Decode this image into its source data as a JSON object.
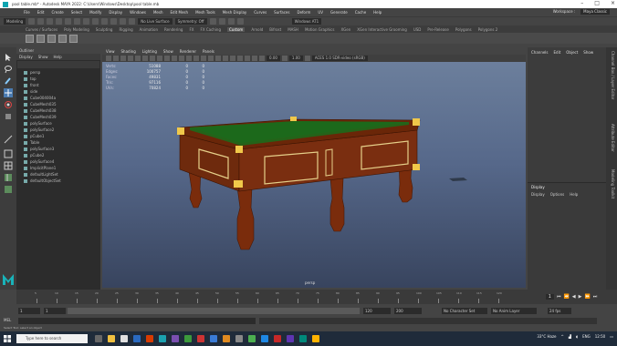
{
  "window": {
    "title": "pool table.mb* - Autodesk MAYA 2022: C:\\Users\\Windows\\Desktop\\pool table.mb"
  },
  "menubar": {
    "items": [
      "File",
      "Edit",
      "Create",
      "Select",
      "Modify",
      "Display",
      "Windows",
      "Mesh",
      "Edit Mesh",
      "Mesh Tools",
      "Mesh Display",
      "Curves",
      "Surfaces",
      "Deform",
      "UV",
      "Generate",
      "Cache",
      "Help"
    ],
    "workspace_label": "Workspace :",
    "workspace_value": "Maya Classic"
  },
  "statusline": {
    "mode": "Modeling",
    "live_surface": "No Live Surface",
    "symmetry": "Symmetry: Off",
    "user": "Windows AT1"
  },
  "shelf": {
    "tabs": [
      "Curves / Surfaces",
      "Poly Modeling",
      "Sculpting",
      "Rigging",
      "Animation",
      "Rendering",
      "FX",
      "FX Caching",
      "Custom",
      "Arnold",
      "Bifrost",
      "MASH",
      "Motion Graphics",
      "XGen",
      "XGen Interactive Grooming",
      "USD",
      "Pre-Release",
      "Polygons",
      "Polygons 2"
    ],
    "active_tab": "Custom"
  },
  "outliner": {
    "title": "Outliner",
    "menu": [
      "Display",
      "Show",
      "Help"
    ],
    "items": [
      "persp",
      "top",
      "front",
      "side",
      "Cube004004a",
      "CubeMesh035",
      "CubeMesh038",
      "CubeMesh039",
      "polySurface",
      "polySurface2",
      "pCube1",
      "Table",
      "polySurface3",
      "pCube2",
      "polySurface4",
      "ImplicitPlane1",
      "defaultLightSet",
      "defaultObjectSet"
    ]
  },
  "viewport": {
    "menu": [
      "View",
      "Shading",
      "Lighting",
      "Show",
      "Renderer",
      "Panels"
    ],
    "gamma_a": "0.00",
    "gamma_b": "1.00",
    "colorspace": "ACES 1.0 SDR-video (sRGB)",
    "camera": "persp",
    "hud": [
      {
        "label": "Verts:",
        "val": "51088",
        "sel": "0",
        "tri": "0"
      },
      {
        "label": "Edges:",
        "val": "100757",
        "sel": "0",
        "tri": "0"
      },
      {
        "label": "Faces:",
        "val": "49831",
        "sel": "0",
        "tri": "0"
      },
      {
        "label": "Tris:",
        "val": "97116",
        "sel": "0",
        "tri": "0"
      },
      {
        "label": "UVs:",
        "val": "70824",
        "sel": "0",
        "tri": "0"
      }
    ]
  },
  "channelbox": {
    "tabs": [
      "Channels",
      "Edit",
      "Object",
      "Show"
    ]
  },
  "layers": {
    "title": "Display",
    "menu": [
      "Display",
      "Options",
      "Help"
    ]
  },
  "sidetabs": [
    "Channel Box / Layer Editor",
    "Attribute Editor",
    "Modeling Toolkit"
  ],
  "timeslider": {
    "ticks": [
      "5",
      "10",
      "15",
      "20",
      "25",
      "30",
      "35",
      "40",
      "45",
      "50",
      "55",
      "60",
      "65",
      "70",
      "75",
      "80",
      "85",
      "90",
      "95",
      "100",
      "105",
      "110",
      "115",
      "120"
    ],
    "current": "1"
  },
  "range": {
    "start": "1",
    "start2": "1",
    "end": "120",
    "end2": "120",
    "end3": "200",
    "character_set": "No Character Set",
    "anim_layer": "No Anim Layer",
    "fps": "24 fps"
  },
  "cmdline": {
    "label": "MEL"
  },
  "helpline": {
    "text": "Select Tool: select an object"
  },
  "taskbar": {
    "search": "Type here to search",
    "weather": "33°C Haze",
    "lang": "ENG",
    "time": "12:50"
  }
}
